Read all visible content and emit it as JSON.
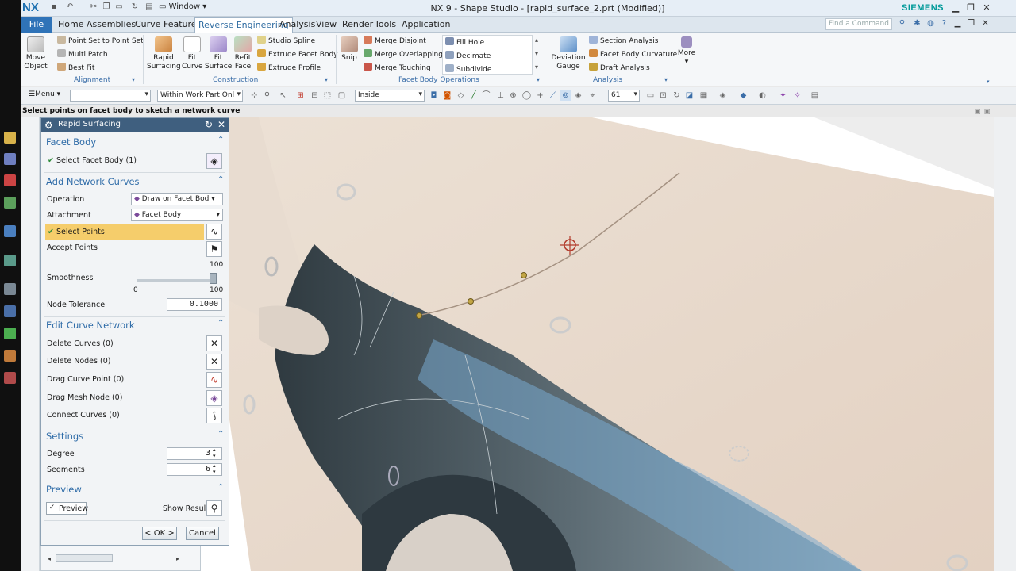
{
  "app": {
    "logo": "NX",
    "window_menu": "Window",
    "title": "NX 9 - Shape Studio - [rapid_surface_2.prt (Modified)]",
    "vendor": "SIEMENS",
    "find_placeholder": "Find a Command"
  },
  "menu": {
    "file": "File",
    "tabs": [
      "Home",
      "Assemblies",
      "Curve",
      "Feature",
      "Reverse Engineering",
      "Analysis",
      "View",
      "Render",
      "Tools",
      "Application"
    ],
    "active": "Reverse Engineering"
  },
  "ribbon": {
    "move_object": "Move Object",
    "alignment": {
      "items": [
        "Point Set to Point Set",
        "Multi Patch",
        "Best Fit"
      ],
      "group": "Alignment"
    },
    "construction": {
      "big": [
        "Rapid Surfacing",
        "Fit Curve",
        "Fit Surface",
        "Refit Face"
      ],
      "small": [
        "Studio Spline",
        "Extrude Facet Body",
        "Extrude Profile"
      ],
      "group": "Construction"
    },
    "facet_ops": {
      "snip": "Snip",
      "merge": [
        "Merge Disjoint",
        "Merge Overlapping",
        "Merge Touching"
      ],
      "list": [
        "Fill Hole",
        "Decimate",
        "Subdivide"
      ],
      "group": "Facet Body Operations"
    },
    "analysis": {
      "deviation": "Deviation Gauge",
      "items": [
        "Section Analysis",
        "Facet Body Curvature",
        "Draft Analysis"
      ],
      "group": "Analysis",
      "more": "More"
    }
  },
  "toolbar": {
    "menu": "Menu",
    "filter": "",
    "scope": "Within Work Part Onl",
    "select_mode": "Inside",
    "count": "61"
  },
  "cue": "Select points on facet body to sketch a network curve",
  "dialog": {
    "title": "Rapid Surfacing",
    "facet_body": {
      "header": "Facet Body",
      "select": "Select Facet Body (1)"
    },
    "network": {
      "header": "Add Network Curves",
      "operation_label": "Operation",
      "operation_value": "Draw on Facet Bod",
      "attachment_label": "Attachment",
      "attachment_value": "Facet Body",
      "select_points": "Select Points",
      "accept_points": "Accept Points",
      "smoothness_label": "Smoothness",
      "smooth_max_top": "100",
      "smooth_min": "0",
      "smooth_max": "100",
      "smoothness_value": 1.0,
      "node_tol_label": "Node Tolerance",
      "node_tol": "0.1000"
    },
    "edit": {
      "header": "Edit Curve Network",
      "items": [
        "Delete Curves (0)",
        "Delete Nodes (0)",
        "Drag Curve Point (0)",
        "Drag Mesh Node (0)",
        "Connect Curves (0)"
      ]
    },
    "settings": {
      "header": "Settings",
      "degree_label": "Degree",
      "degree": "3",
      "segments_label": "Segments",
      "segments": "6"
    },
    "preview": {
      "header": "Preview",
      "preview_label": "Preview",
      "show_result": "Show Result"
    },
    "ok": "< OK >",
    "cancel": "Cancel"
  },
  "colors": {
    "accent": "#2f6ca8",
    "dialog_header": "#3f5f7f",
    "highlight": "#f5cd6b",
    "body": "#e8d9cb",
    "dark_panel": "#4e5d66",
    "blue_scan": "#79a9cf"
  }
}
